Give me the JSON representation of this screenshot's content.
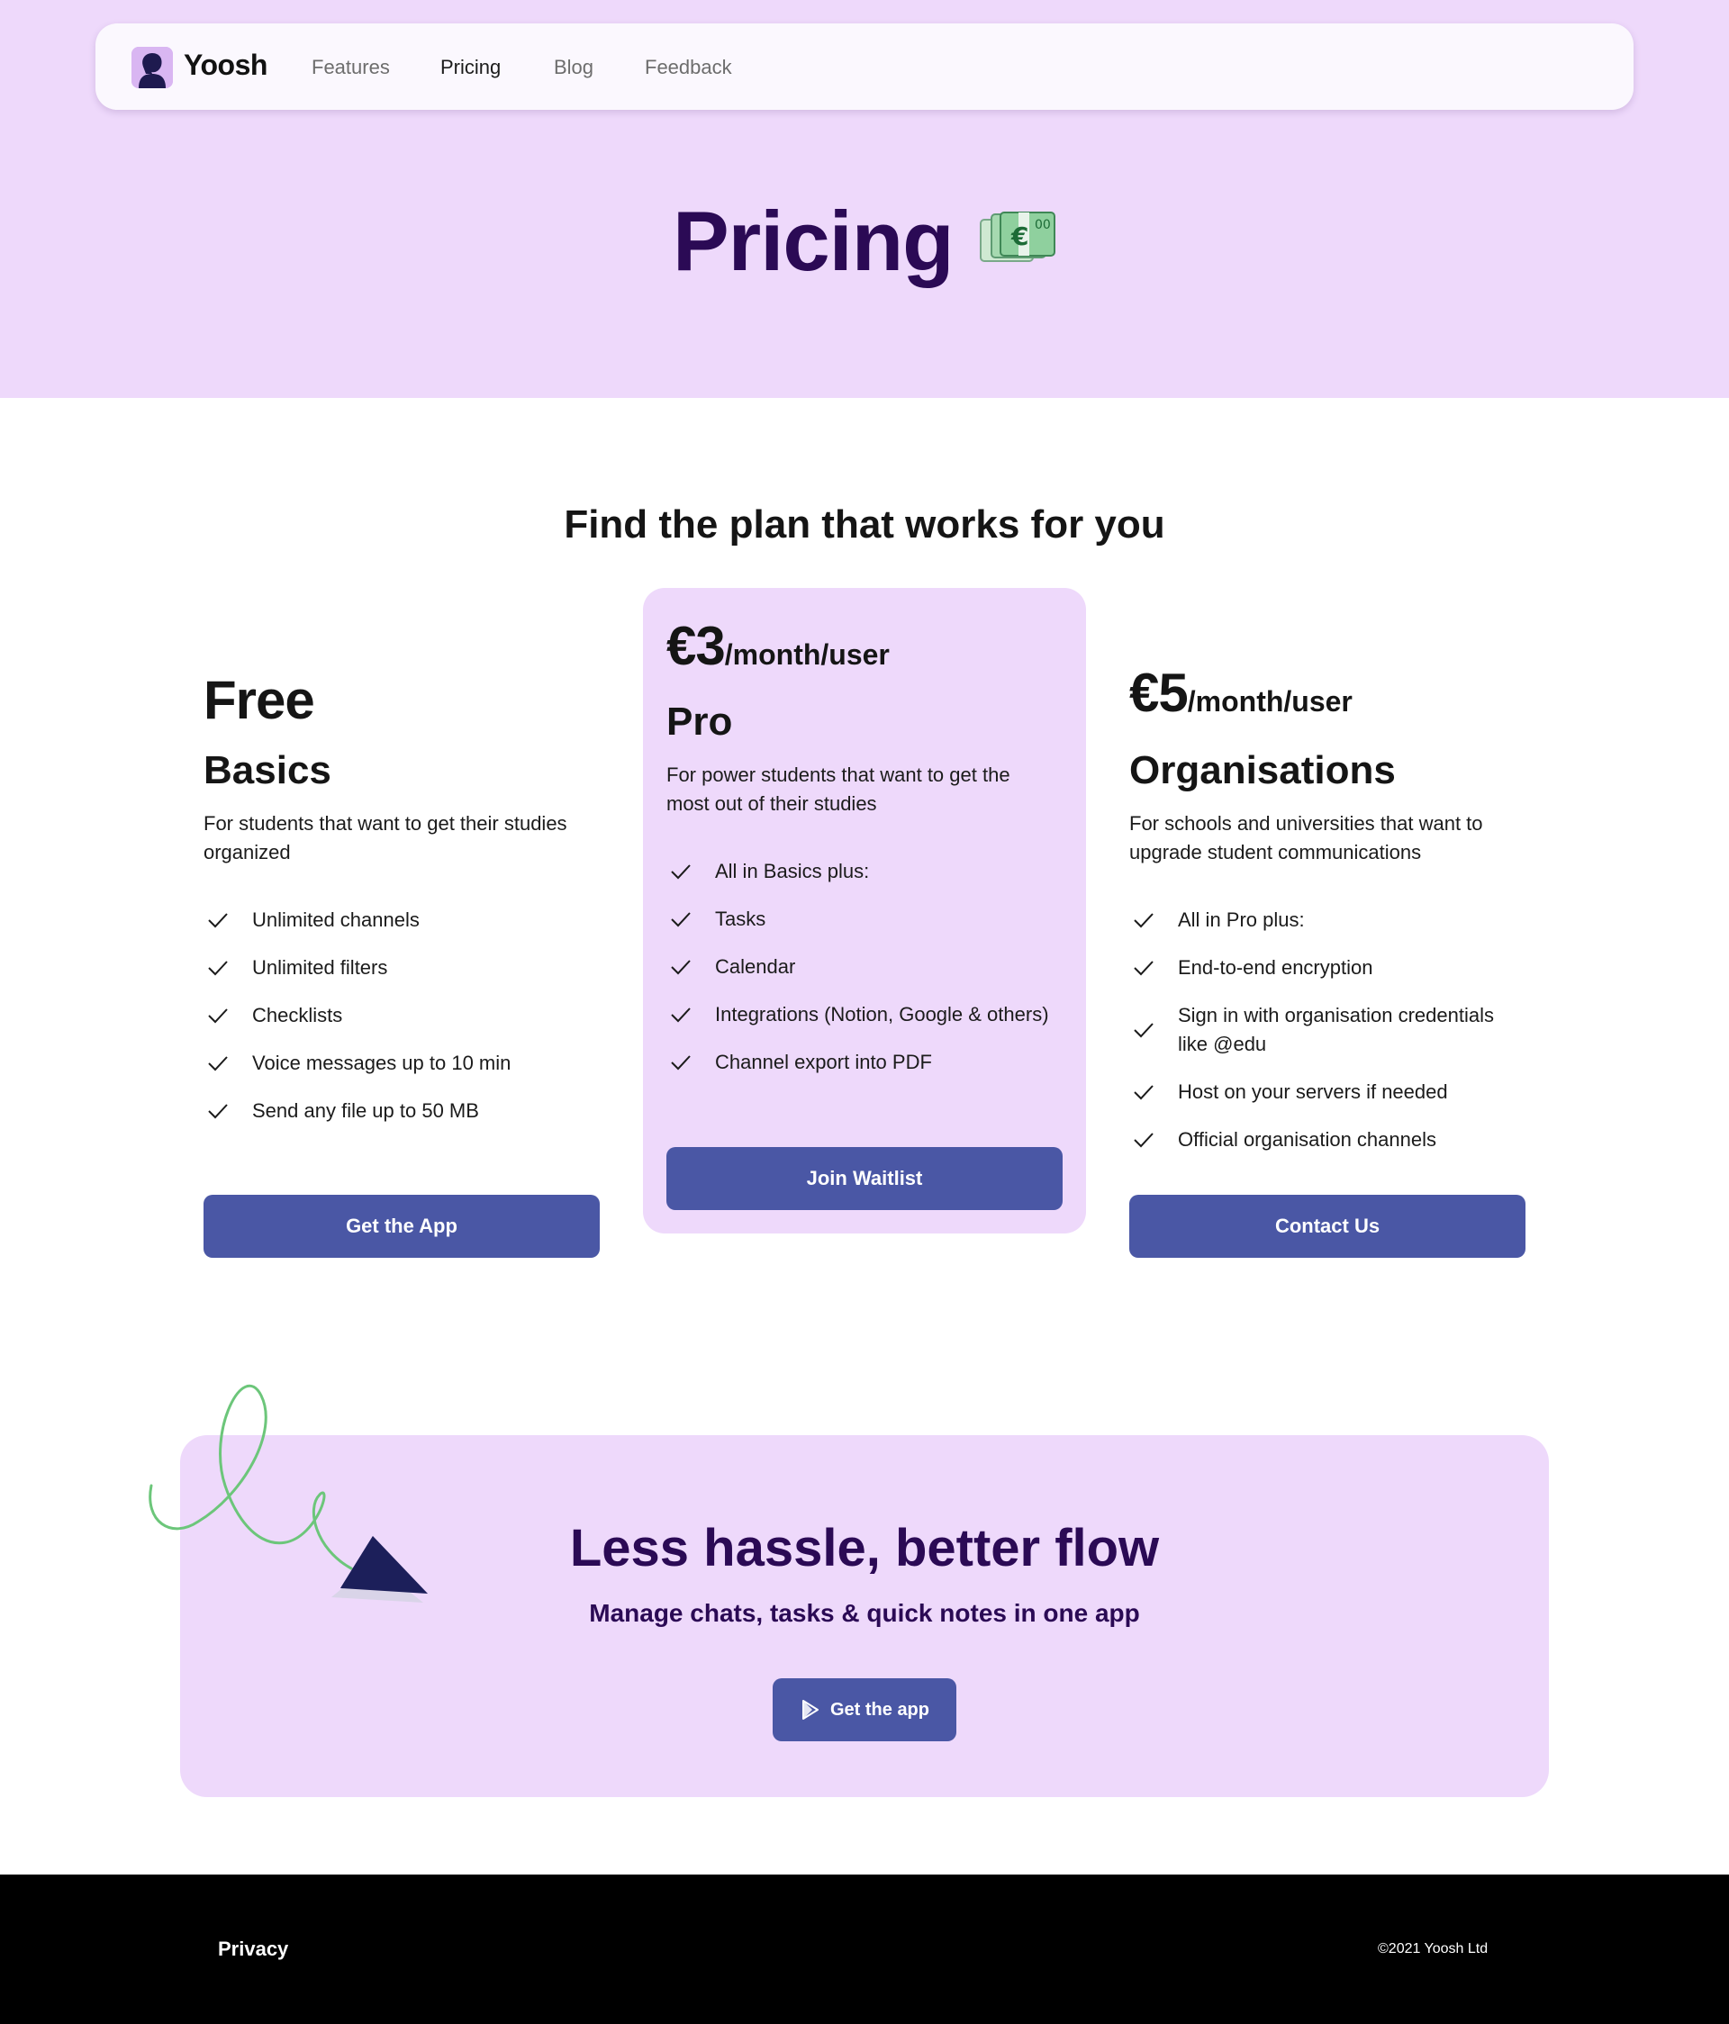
{
  "nav": {
    "logo_text": "Yoosh",
    "links": [
      {
        "label": "Features",
        "active": false
      },
      {
        "label": "Pricing",
        "active": true
      },
      {
        "label": "Blog",
        "active": false
      },
      {
        "label": "Feedback",
        "active": false
      }
    ]
  },
  "hero": {
    "title": "Pricing",
    "icon": "euro-banknote-icon"
  },
  "pricing": {
    "title": "Find the plan that works for you",
    "plans": [
      {
        "price": "Free",
        "price_suffix": "",
        "name": "Basics",
        "description": "For students that want to get their studies organized",
        "features": [
          "Unlimited channels",
          "Unlimited filters",
          "Checklists",
          "Voice messages up to 10 min",
          "Send any file up to 50 MB"
        ],
        "button": "Get the App"
      },
      {
        "price": "€3",
        "price_suffix": "/month/user",
        "name": "Pro",
        "description": "For power students that want to get the most out of their studies",
        "features": [
          "All in Basics plus:",
          "Tasks",
          "Calendar",
          "Integrations (Notion, Google & others)",
          "Channel export into PDF"
        ],
        "button": "Join Waitlist"
      },
      {
        "price": "€5",
        "price_suffix": "/month/user",
        "name": "Organisations",
        "description": "For schools and universities that want to upgrade student communications",
        "features": [
          "All in Pro plus:",
          "End-to-end encryption",
          "Sign in with organisation credentials like @edu",
          "Host on your servers if needed",
          "Official organisation channels"
        ],
        "button": "Contact Us"
      }
    ]
  },
  "cta": {
    "title": "Less hassle, better flow",
    "subtitle": "Manage chats, tasks & quick notes in one app",
    "button": "Get the app"
  },
  "footer": {
    "privacy": "Privacy",
    "copyright": "©2021 Yoosh Ltd"
  },
  "colors": {
    "hero_bg": "#eed9fb",
    "heading_purple": "#2b0a55",
    "button_blue": "#4a57a5",
    "footer_bg": "#000000"
  }
}
